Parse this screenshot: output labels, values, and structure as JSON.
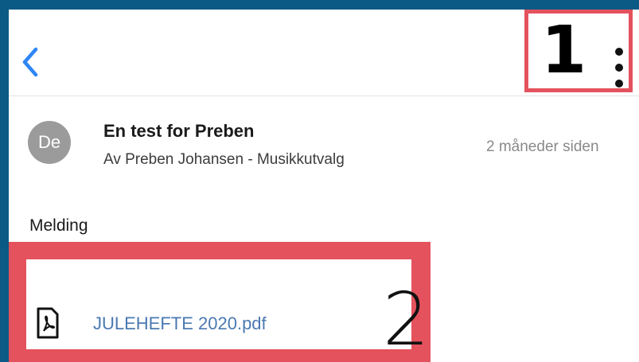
{
  "header": {
    "back_icon": "chevron-left-icon",
    "menu_icon": "kebab-menu-icon",
    "annotation_number": "1"
  },
  "post": {
    "avatar_initials": "De",
    "title": "En test for Preben",
    "author_line": "Av Preben Johansen - Musikkutvalg",
    "time_ago": "2 måneder siden"
  },
  "message": {
    "section_label": "Melding"
  },
  "attachment": {
    "icon": "pdf-file-icon",
    "filename": "JULEHEFTE 2020.pdf",
    "annotation_number": "2"
  },
  "colors": {
    "outer_background": "#0b5985",
    "annotation_red": "#e4525d",
    "link_blue": "#4a79b2",
    "back_blue": "#2f86f6"
  }
}
